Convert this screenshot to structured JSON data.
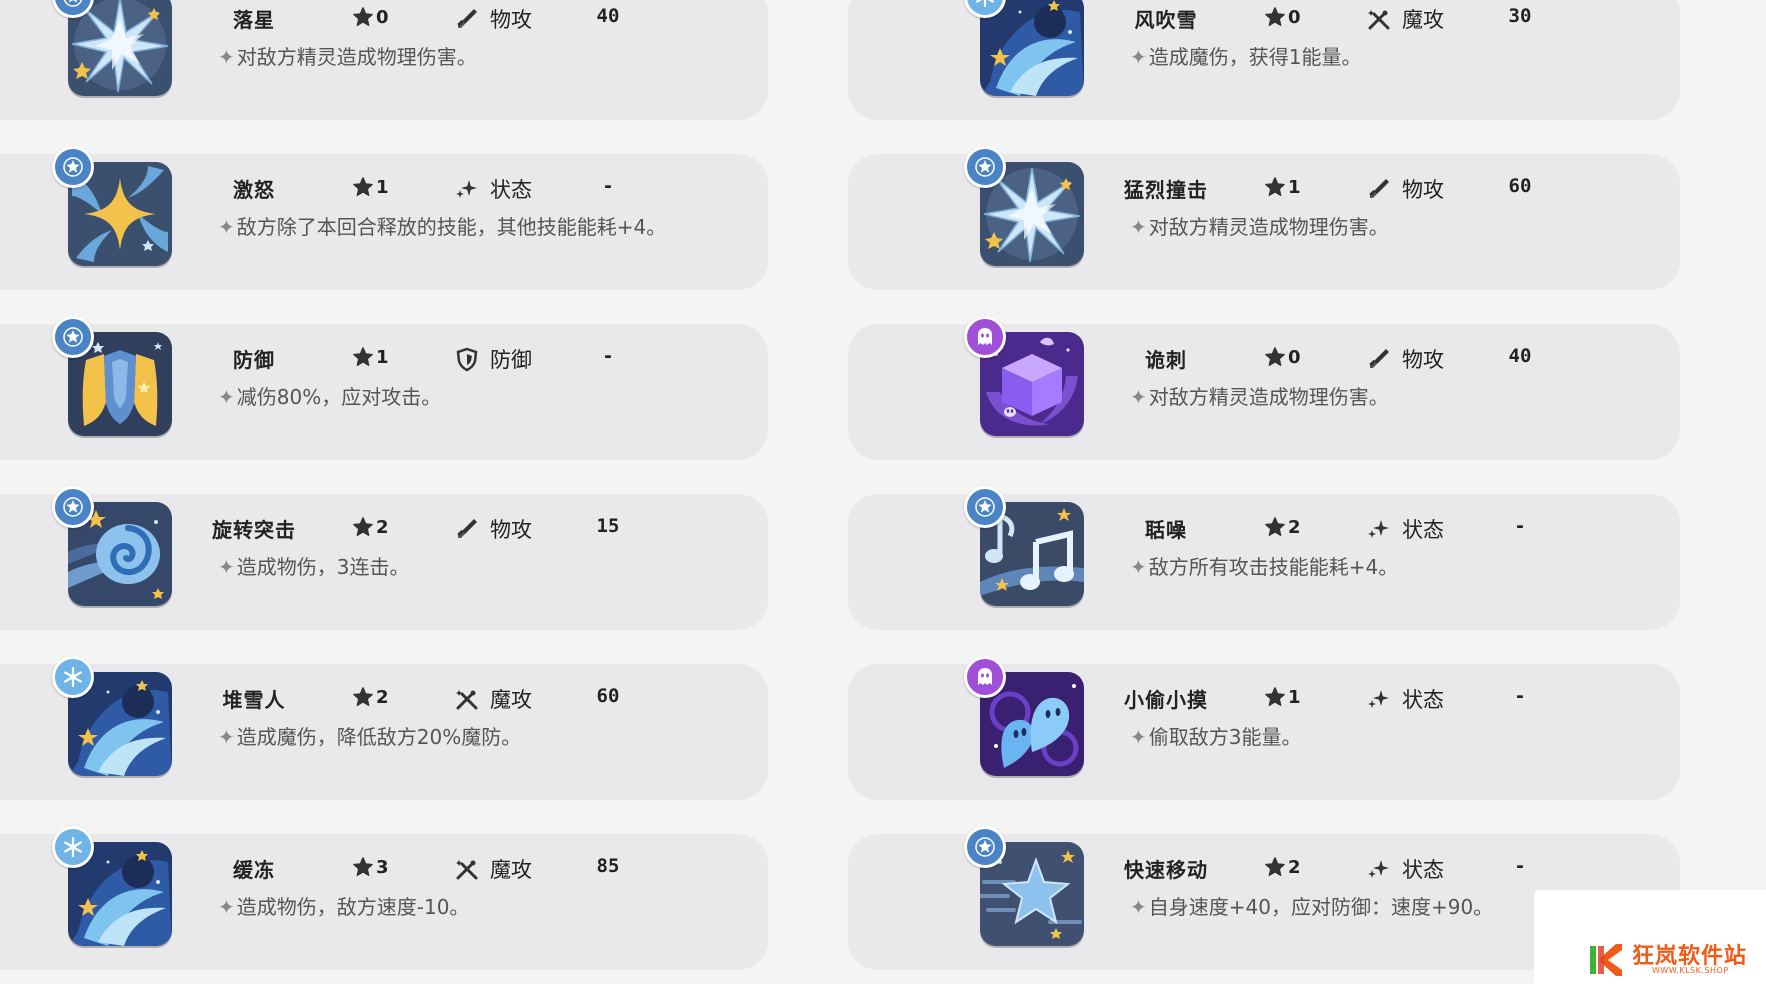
{
  "skills": [
    {
      "name": "落星",
      "cost": "0",
      "type": "物攻",
      "type_icon": "sword-icon",
      "power": "40",
      "desc": "对敌方精灵造成物理伤害。",
      "attr": "normal",
      "art": "burst"
    },
    {
      "name": "风吹雪",
      "cost": "0",
      "type": "魔攻",
      "type_icon": "wand-icon",
      "power": "30",
      "desc": "造成魔伤，获得1能量。",
      "attr": "ice",
      "art": "swirl"
    },
    {
      "name": "激怒",
      "cost": "1",
      "type": "状态",
      "type_icon": "sparkle-icon",
      "power": "-",
      "desc": "敌方除了本回合释放的技能，其他技能能耗+4。",
      "attr": "normal",
      "art": "fourstar"
    },
    {
      "name": "猛烈撞击",
      "cost": "1",
      "type": "物攻",
      "type_icon": "sword-icon",
      "power": "60",
      "desc": "对敌方精灵造成物理伤害。",
      "attr": "normal",
      "art": "burst"
    },
    {
      "name": "防御",
      "cost": "1",
      "type": "防御",
      "type_icon": "shield-icon",
      "power": "-",
      "desc": "减伤80%，应对攻击。",
      "attr": "normal",
      "art": "shields"
    },
    {
      "name": "诡刺",
      "cost": "0",
      "type": "物攻",
      "type_icon": "sword-icon",
      "power": "40",
      "desc": "对敌方精灵造成物理伤害。",
      "attr": "ghost",
      "art": "cube"
    },
    {
      "name": "旋转突击",
      "cost": "2",
      "type": "物攻",
      "type_icon": "sword-icon",
      "power": "15",
      "desc": "造成物伤，3连击。",
      "attr": "normal",
      "art": "spin"
    },
    {
      "name": "聒噪",
      "cost": "2",
      "type": "状态",
      "type_icon": "sparkle-icon",
      "power": "-",
      "desc": "敌方所有攻击技能能耗+4。",
      "attr": "normal",
      "art": "music"
    },
    {
      "name": "堆雪人",
      "cost": "2",
      "type": "魔攻",
      "type_icon": "wand-icon",
      "power": "60",
      "desc": "造成魔伤，降低敌方20%魔防。",
      "attr": "ice",
      "art": "swirl"
    },
    {
      "name": "小偷小摸",
      "cost": "1",
      "type": "状态",
      "type_icon": "sparkle-icon",
      "power": "-",
      "desc": "偷取敌方3能量。",
      "attr": "ghost",
      "art": "ghosts"
    },
    {
      "name": "缓冻",
      "cost": "3",
      "type": "魔攻",
      "type_icon": "wand-icon",
      "power": "85",
      "desc": "造成物伤，敌方速度-10。",
      "attr": "ice",
      "art": "swirl"
    },
    {
      "name": "快速移动",
      "cost": "2",
      "type": "状态",
      "type_icon": "sparkle-icon",
      "power": "-",
      "desc": "自身速度+40，应对防御：速度+90。",
      "attr": "normal",
      "art": "dash"
    }
  ],
  "bullet": "✦",
  "colors": {
    "normal_badge": "#4a84c4",
    "ice_badge": "#6fb4e6",
    "ghost_badge": "#a04fd8",
    "tile_blue": "#3b4f6e",
    "tile_purple": "#4a2a8c",
    "gold": "#f2c24a"
  },
  "watermark": {
    "text": "狂岚软件站",
    "url": "WWW.KLSK.SHOP"
  }
}
